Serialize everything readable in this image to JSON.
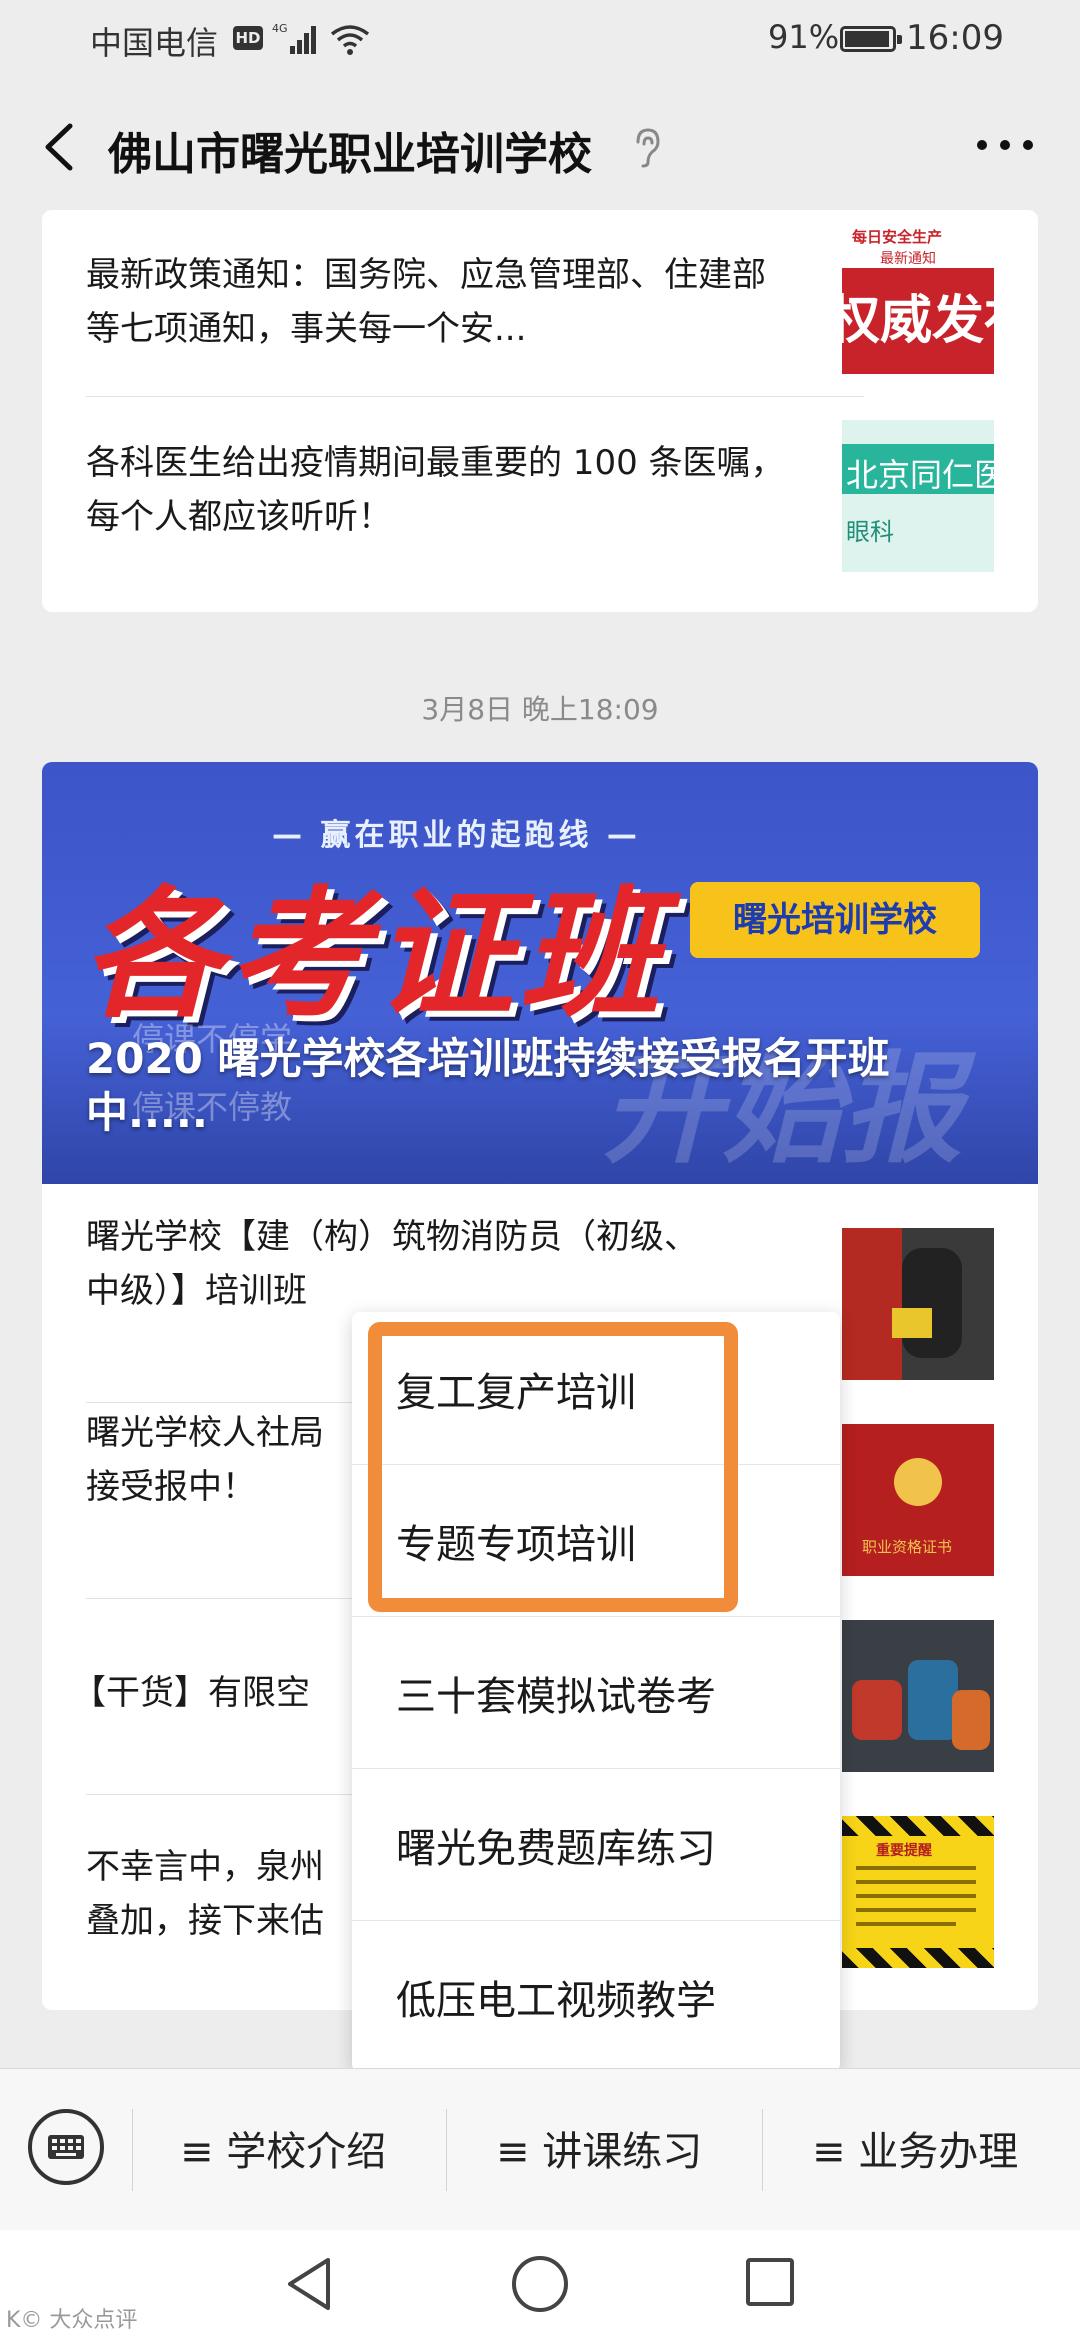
{
  "status_bar": {
    "carrier": "中国电信",
    "hd": "HD",
    "network": "4G",
    "battery": "91%",
    "time": "16:09"
  },
  "header": {
    "title": "佛山市曙光职业培训学校",
    "back_icon": "chevron-left-icon",
    "more_icon": "more-dots-icon",
    "ear_icon": "ear-icon"
  },
  "card1": {
    "items": [
      {
        "title": "最新政策通知：国务院、应急管理部、住建部等七项通知，事关每一个安...",
        "thumb_top": "每日安全生产",
        "thumb_mid": "最新通知",
        "thumb_big": "权威发布"
      },
      {
        "title": "各科医生给出疫情期间最重要的 100 条医嘱，每个人都应该听听！",
        "thumb_big": "北京同仁医",
        "thumb_small": "眼科"
      }
    ]
  },
  "timestamp": "3月8日 晚上18:09",
  "card2": {
    "banner": {
      "slogan": "— 赢在职业的起跑线 —",
      "big_text": "各考证班",
      "tag": "曙光培训学校",
      "bg_text_1": "停课不停学",
      "bg_text_2": "停课不停教",
      "bg_text_3": "开始报名啦",
      "caption": "2020 曙光学校各培训班持续接受报名开班中....."
    },
    "items": [
      {
        "title_line1": "曙光学校【建（构）筑物消防员（初级、",
        "title_line2": "中级）】培训班"
      },
      {
        "title_line1": "曙光学校人社局",
        "title_line2": "接受报中！",
        "thumb_text": "职业资格证书"
      },
      {
        "title_line1": "【干货】有限空"
      },
      {
        "title_line1": "不幸言中，泉州",
        "title_line2": "叠加，接下来估",
        "thumb_text": "重要提醒"
      }
    ]
  },
  "popup_menu": {
    "items": [
      "复工复产培训",
      "专题专项培训",
      "三十套模拟试卷考",
      "曙光免费题库练习",
      "低压电工视频教学"
    ]
  },
  "bottom_menu": {
    "keyboard_icon": "keyboard-icon",
    "tabs": [
      "≡ 学校介绍",
      "≡ 讲课练习",
      "≡ 业务办理"
    ]
  },
  "navbar": {
    "back_icon": "triangle-back-icon",
    "home_icon": "circle-home-icon",
    "recent_icon": "square-recent-icon"
  },
  "watermark": "K© 大众点评",
  "colors": {
    "accent_highlight": "#f08c3a",
    "banner_blue": "#4561d6",
    "banner_red": "#e3262a",
    "banner_tag": "#f7c21a"
  }
}
